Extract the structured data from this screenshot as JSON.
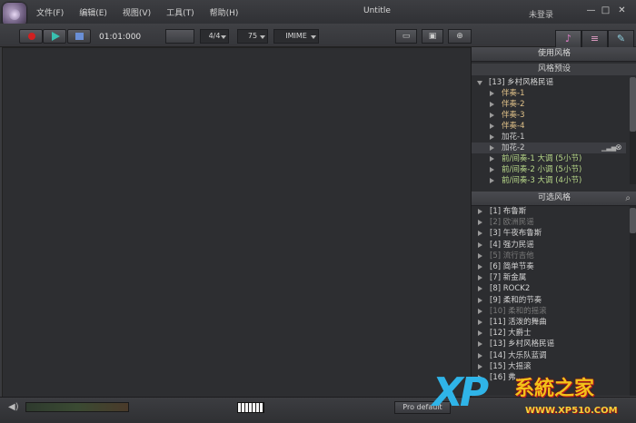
{
  "window": {
    "title": "Untitle",
    "login": "未登录",
    "min_glyph": "—",
    "max_glyph": "□",
    "close_glyph": "✕"
  },
  "menu": [
    "文件(F)",
    "编辑(E)",
    "视图(V)",
    "工具(T)",
    "帮助(H)"
  ],
  "toolbar": {
    "time": "01:01:000",
    "time_signature": "4/4",
    "tempo": "75",
    "input_mode": "IMIME"
  },
  "panel": {
    "use_style_header": "使用风格",
    "presets_header": "风格预设",
    "root_item": "[13] 乡村风格民谣",
    "preset_items": [
      {
        "label": "伴奏-1",
        "color": "#e2c38a"
      },
      {
        "label": "伴奏-2",
        "color": "#e2c38a"
      },
      {
        "label": "伴奏-3",
        "color": "#e2c38a"
      },
      {
        "label": "伴奏-4",
        "color": "#e2c38a"
      },
      {
        "label": "加花-1",
        "color": "#cfcfcf"
      },
      {
        "label": "加花-2",
        "color": "#cfcfcf"
      },
      {
        "label": "前/间奏-1 大调 (5小节)",
        "color": "#b9d98a"
      },
      {
        "label": "前/间奏-2 小调 (5小节)",
        "color": "#b9d98a"
      },
      {
        "label": "前/间奏-3 大调 (4小节)",
        "color": "#b9d98a"
      }
    ],
    "available_header": "可选风格",
    "style_items": [
      {
        "label": "[1] 布鲁斯",
        "dim": false
      },
      {
        "label": "[2] 欧洲民谣",
        "dim": true
      },
      {
        "label": "[3] 午夜布鲁斯",
        "dim": false
      },
      {
        "label": "[4] 强力民谣",
        "dim": false
      },
      {
        "label": "[5] 流行吉他",
        "dim": true
      },
      {
        "label": "[6] 简单节奏",
        "dim": false
      },
      {
        "label": "[7] 新金属",
        "dim": false
      },
      {
        "label": "[8] ROCK2",
        "dim": false
      },
      {
        "label": "[9] 柔和的节奏",
        "dim": false
      },
      {
        "label": "[10] 柔和的摇滚",
        "dim": true
      },
      {
        "label": "[11] 活泼的舞曲",
        "dim": false
      },
      {
        "label": "[12] 大爵士",
        "dim": false
      },
      {
        "label": "[13] 乡村风格民谣",
        "dim": false
      },
      {
        "label": "[14] 大乐队蓝调",
        "dim": false
      },
      {
        "label": "[15] 大摇滚",
        "dim": false
      },
      {
        "label": "[16] 弗...",
        "dim": false
      }
    ]
  },
  "bottombar": {
    "preset_button": "Pro default"
  },
  "watermark": {
    "brand_xp": "XP",
    "brand_cn": "系統之家",
    "url": "WWW.XP510.COM"
  }
}
